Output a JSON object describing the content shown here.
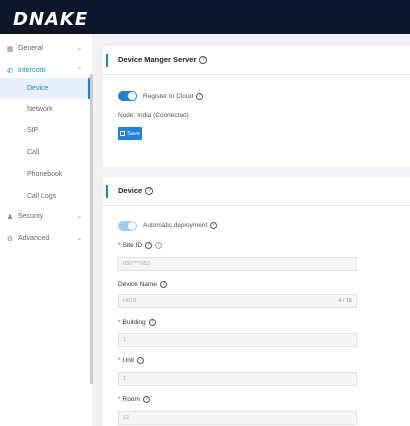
{
  "brand": {
    "logo_text": "DNAKE"
  },
  "sidebar": {
    "general": {
      "label": "General",
      "icon": "grid-icon"
    },
    "intercom": {
      "label": "Intercom",
      "icon": "phone-icon"
    },
    "sub_items": [
      "Device",
      "Network",
      "SIP",
      "Call",
      "Phonebook",
      "Call Logs"
    ],
    "active_sub": "Device",
    "security": {
      "label": "Security",
      "icon": "person-icon"
    },
    "advanced": {
      "label": "Advanced",
      "icon": "gear-icon"
    }
  },
  "server_card": {
    "title": "Device Manger Server",
    "register_label": "Register to Cloud",
    "register_enabled": true,
    "node_label": "Node:",
    "node_value": "India (Connected)",
    "save_label": "Save"
  },
  "device_card": {
    "title": "Device",
    "auto_deploy_label": "Automatic deployment",
    "auto_deploy_enabled": true,
    "site_id": {
      "label": "Site ID",
      "value": "030****652"
    },
    "device_name": {
      "label": "Device Name",
      "value": "H618",
      "counter": "4 / 16"
    },
    "building": {
      "label": "Building",
      "value": "1"
    },
    "unit": {
      "label": "Unit",
      "value": "1"
    },
    "room": {
      "label": "Room",
      "value": "12"
    }
  },
  "colors": {
    "accent": "#1a82e2",
    "topbar": "#0d1729",
    "background": "#f0f2f5",
    "required": "#e0312f"
  }
}
